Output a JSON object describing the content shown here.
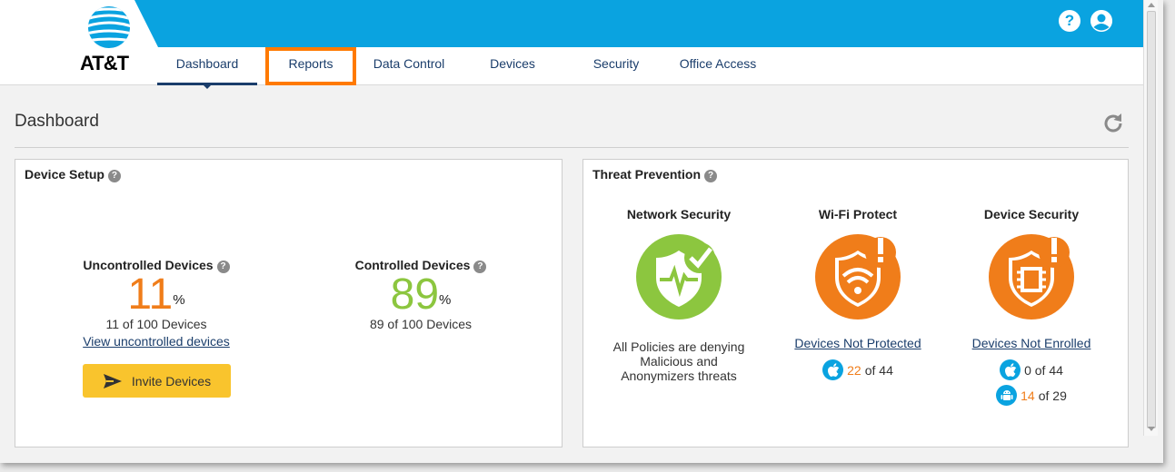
{
  "brand": {
    "name": "AT&T"
  },
  "header": {
    "help_icon": "?",
    "user_icon": "user-circle-icon"
  },
  "nav": {
    "tabs": [
      {
        "label": "Dashboard",
        "active": true
      },
      {
        "label": "Reports",
        "highlighted": true
      },
      {
        "label": "Data Control"
      },
      {
        "label": "Devices"
      },
      {
        "label": "Security"
      },
      {
        "label": "Office Access"
      }
    ]
  },
  "page": {
    "title": "Dashboard"
  },
  "device_setup": {
    "title": "Device Setup",
    "help": "?",
    "uncontrolled": {
      "label": "Uncontrolled Devices",
      "help": "?",
      "value": "11",
      "unit": "%",
      "sub": "11 of 100 Devices",
      "link": "View uncontrolled devices"
    },
    "controlled": {
      "label": "Controlled Devices",
      "help": "?",
      "value": "89",
      "unit": "%",
      "sub": "89 of 100 Devices"
    },
    "invite_label": "Invite Devices"
  },
  "threat_prevention": {
    "title": "Threat Prevention",
    "help": "?",
    "network_security": {
      "title": "Network Security",
      "desc": "All Policies are denying Malicious and Anonymizers threats"
    },
    "wifi_protect": {
      "title": "Wi-Fi Protect",
      "link": "Devices Not Protected",
      "ios_count": "22",
      "ios_total": " of 44"
    },
    "device_security": {
      "title": "Device Security",
      "link": "Devices Not Enrolled",
      "ios_line": "0 of 44",
      "android_count": "14",
      "android_total": " of 29"
    }
  },
  "colors": {
    "accent": "#0aa3e0",
    "nav": "#1a3d6b",
    "orange": "#f07d1a",
    "green": "#8cc63f",
    "yellow": "#f9c42d",
    "highlight": "#ff7a00"
  }
}
